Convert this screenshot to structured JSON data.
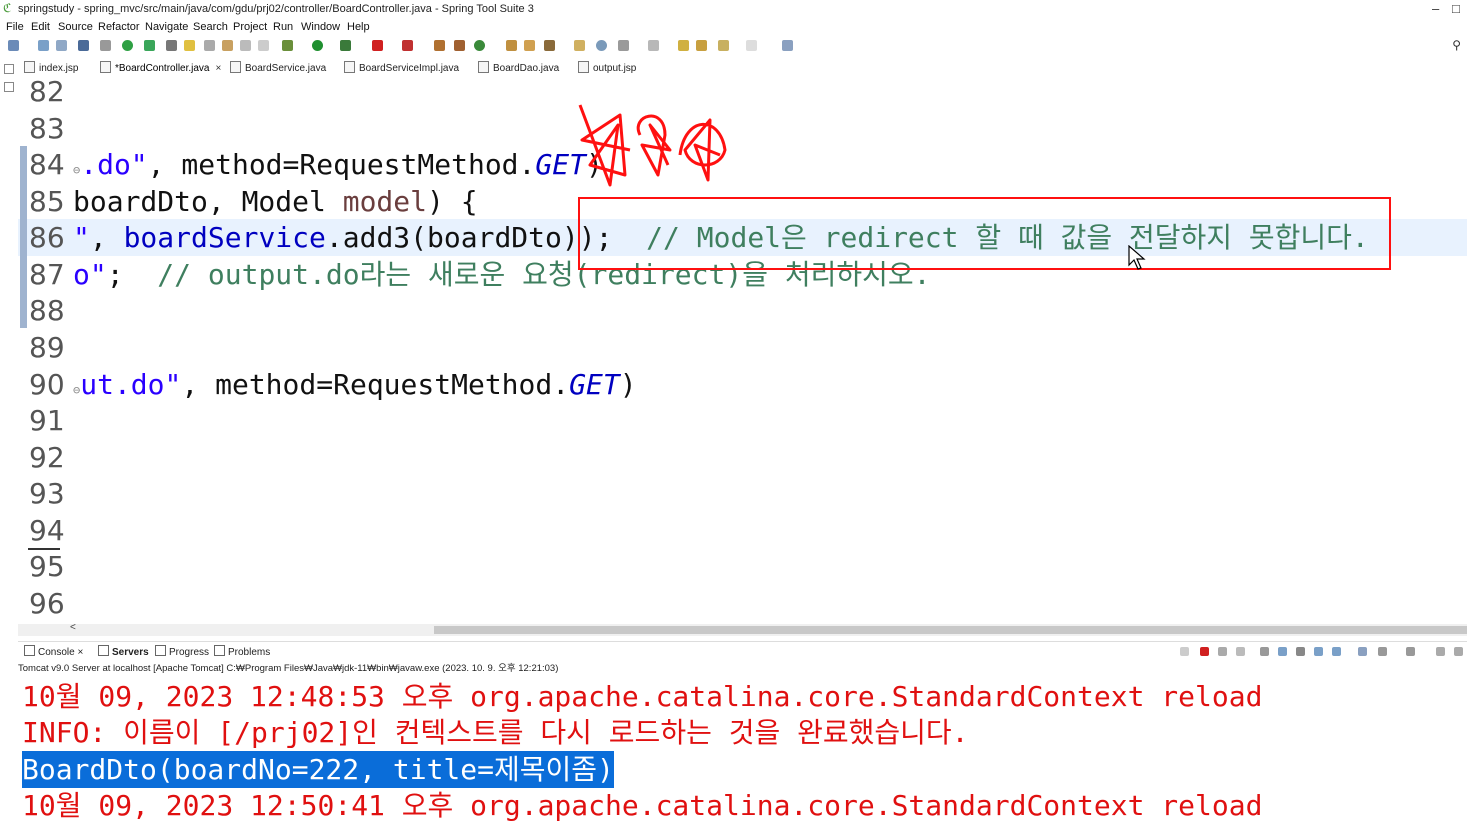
{
  "window": {
    "title": "springstudy - spring_mvc/src/main/java/com/gdu/prj02/controller/BoardController.java - Spring Tool Suite 3",
    "minimize": "–",
    "maximize": "□"
  },
  "menu": [
    "File",
    "Edit",
    "Source",
    "Refactor",
    "Navigate",
    "Search",
    "Project",
    "Run",
    "Window",
    "Help"
  ],
  "tabs": [
    {
      "label": "index.jsp"
    },
    {
      "label": "*BoardController.java",
      "close": "×"
    },
    {
      "label": "BoardService.java"
    },
    {
      "label": "BoardServiceImpl.java"
    },
    {
      "label": "BoardDao.java"
    },
    {
      "label": "output.jsp"
    }
  ],
  "editor": {
    "lines": [
      {
        "num": "82"
      },
      {
        "num": "83"
      },
      {
        "num": "84",
        "fold": "⊖",
        "p1": ".do\"",
        "p2": ", method=RequestMethod.",
        "p3": "GET",
        "p4": ")"
      },
      {
        "num": "85",
        "p1": "boardDto, Model ",
        "p2": "model",
        "p3": ") {"
      },
      {
        "num": "86",
        "p1": "\"",
        "p2": ", ",
        "p3": "boardService",
        "p4": ".add3(boardDto));  ",
        "p5": "// Model은 redirect 할 때 값을 전달하지 못합니다."
      },
      {
        "num": "87",
        "p1": "o\"",
        "p2": ";  ",
        "p3": "// output.do라는 새로운 요청(redirect)을 처리하시오."
      },
      {
        "num": "88"
      },
      {
        "num": "89"
      },
      {
        "num": "90",
        "fold": "⊖",
        "p1": "ut.do\"",
        "p2": ", method=RequestMethod.",
        "p3": "GET",
        "p4": ")"
      },
      {
        "num": "91"
      },
      {
        "num": "92"
      },
      {
        "num": "93"
      },
      {
        "num": "94"
      },
      {
        "num": "95"
      },
      {
        "num": "96"
      }
    ],
    "scroll_left_arrow": "<"
  },
  "console_tabs": [
    {
      "label": "Console",
      "close": "×"
    },
    {
      "label": "Servers"
    },
    {
      "label": "Progress"
    },
    {
      "label": "Problems"
    }
  ],
  "console": {
    "header": "Tomcat v9.0 Server at localhost [Apache Tomcat] C:₩Program Files₩Java₩jdk-11₩bin₩javaw.exe  (2023. 10. 9. 오후 12:21:03)",
    "lines": [
      "10월 09, 2023 12:48:53 오후 org.apache.catalina.core.StandardContext reload",
      "INFO: 이름이 [/prj02]인 컨텍스트를 다시 로드하는 것을 완료했습니다.",
      "BoardDto(boardNo=222, title=제목이좀)",
      "10월 09, 2023 12:50:41 오후 org.apache.catalina.core.StandardContext reload"
    ]
  },
  "colors": {
    "annotation_red": "#ff1010",
    "console_red": "#e01010",
    "selection_blue": "#0a6dd9",
    "current_line": "#e8f2fe"
  }
}
